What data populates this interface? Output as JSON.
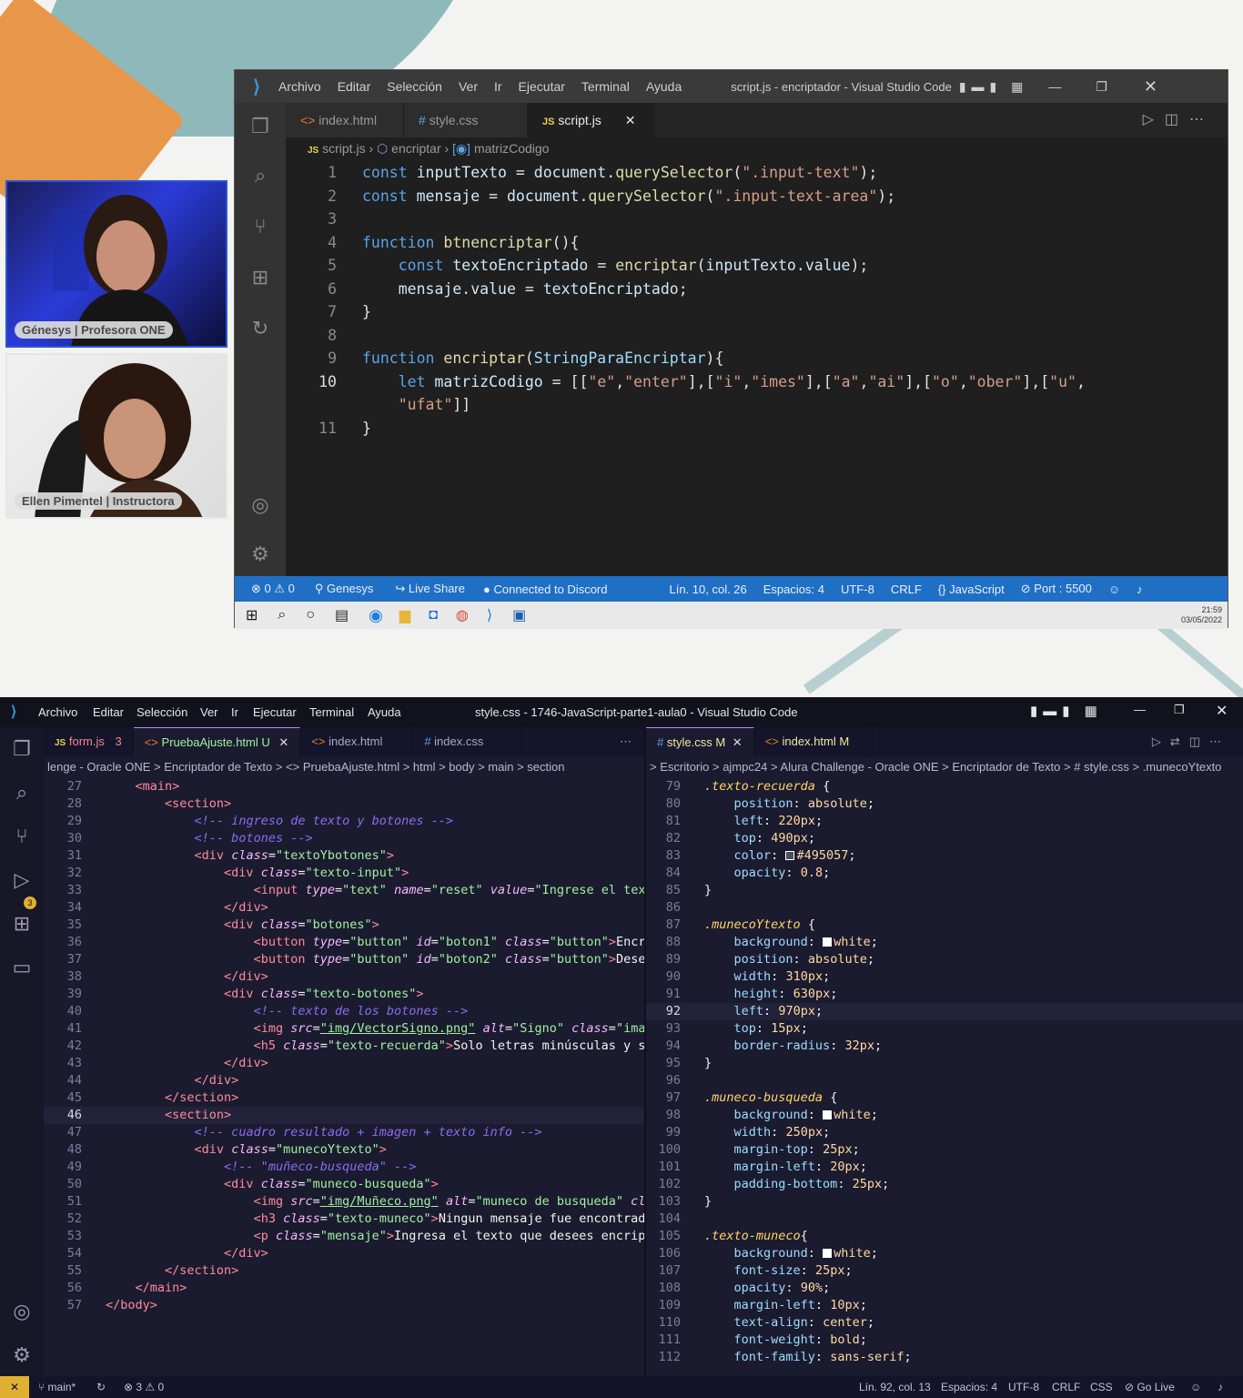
{
  "webcams": [
    {
      "label": "Génesys | Profesora ONE"
    },
    {
      "label": "Ellen Pimentel | Instructora"
    }
  ],
  "inner_editor": {
    "menu": [
      "Archivo",
      "Editar",
      "Selección",
      "Ver",
      "Ir",
      "Ejecutar",
      "Terminal",
      "Ayuda"
    ],
    "title": "script.js - encriptador - Visual Studio Code",
    "tabs": [
      {
        "label": "index.html",
        "icon": "<>"
      },
      {
        "label": "style.css",
        "icon": "#"
      },
      {
        "label": "script.js",
        "icon": "JS",
        "active": true
      }
    ],
    "breadcrumb": [
      "script.js",
      "encriptar",
      "matrizCodigo"
    ],
    "status": {
      "errors": "0",
      "warnings": "0",
      "branch": "Genesys",
      "live_share": "Live Share",
      "discord": "Connected to Discord",
      "position": "Lín. 10, col. 26",
      "spaces": "Espacios: 4",
      "encoding": "UTF-8",
      "eol": "CRLF",
      "language": "JavaScript",
      "port": "Port : 5500"
    },
    "clock": {
      "time": "21:59",
      "date": "03/05/2022"
    }
  },
  "outer_editor": {
    "menu": [
      "Archivo",
      "Editar",
      "Selección",
      "Ver",
      "Ir",
      "Terminal",
      "Ayuda"
    ],
    "title": "style.css - 1746-JavaScript-parte1-aula0 - Visual Studio Code",
    "left_tabs": [
      {
        "label": "form.js",
        "icon": "JS",
        "badge": "3"
      },
      {
        "label": "PruebaAjuste.html",
        "icon": "<>",
        "badge": "U",
        "active": true
      },
      {
        "label": "index.html",
        "icon": "<>"
      },
      {
        "label": "index.css",
        "icon": "#"
      }
    ],
    "right_tabs": [
      {
        "label": "style.css",
        "icon": "#",
        "badge": "M",
        "active": true
      },
      {
        "label": "index.html",
        "icon": "<>",
        "badge": "M"
      }
    ],
    "left_breadcrumb": "lenge - Oracle ONE > Encriptador de Texto > <> PruebaAjuste.html > html > body > main > section",
    "right_breadcrumb": "> Escritorio > ajmpc24 > Alura Challenge - Oracle ONE > Encriptador de Texto > # style.css > .munecoYtexto",
    "activity_badge": "3",
    "status": {
      "branch": "main*",
      "errors": "3",
      "warnings": "0",
      "position": "Lín. 92, col. 13",
      "spaces": "Espacios: 4",
      "encoding": "UTF-8",
      "eol": "CRLF",
      "language": "CSS",
      "golive": "Go Live"
    }
  }
}
